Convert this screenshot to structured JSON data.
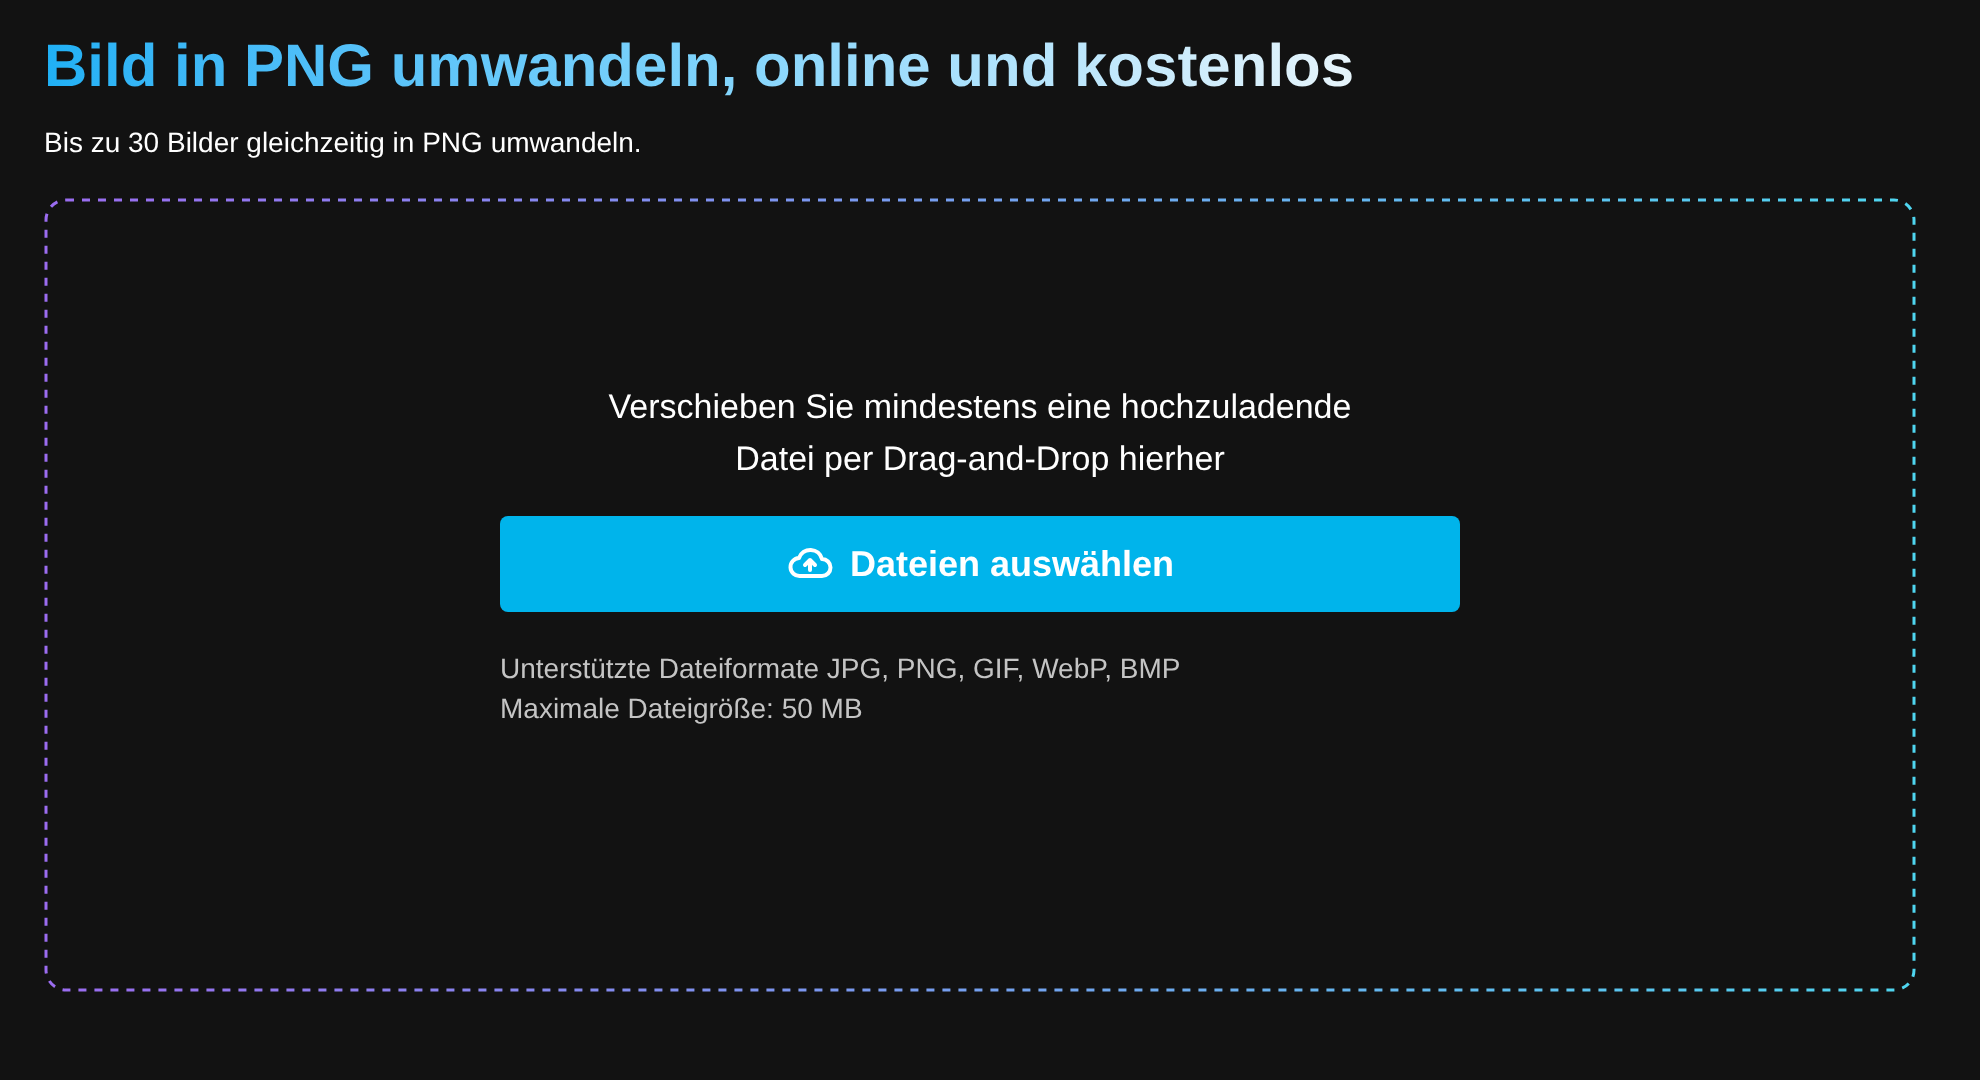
{
  "title": "Bild in PNG umwandeln, online und kostenlos",
  "subtitle": "Bis zu 30 Bilder gleichzeitig in PNG umwandeln.",
  "dropzone": {
    "instruction": "Verschieben Sie mindestens eine hochzuladende Datei per Drag-and-Drop hierher",
    "button": "Dateien auswählen",
    "notes": [
      "Unterstützte Dateiformate JPG, PNG, GIF, WebP, BMP",
      "Maximale Dateigröße: 50 MB"
    ]
  }
}
